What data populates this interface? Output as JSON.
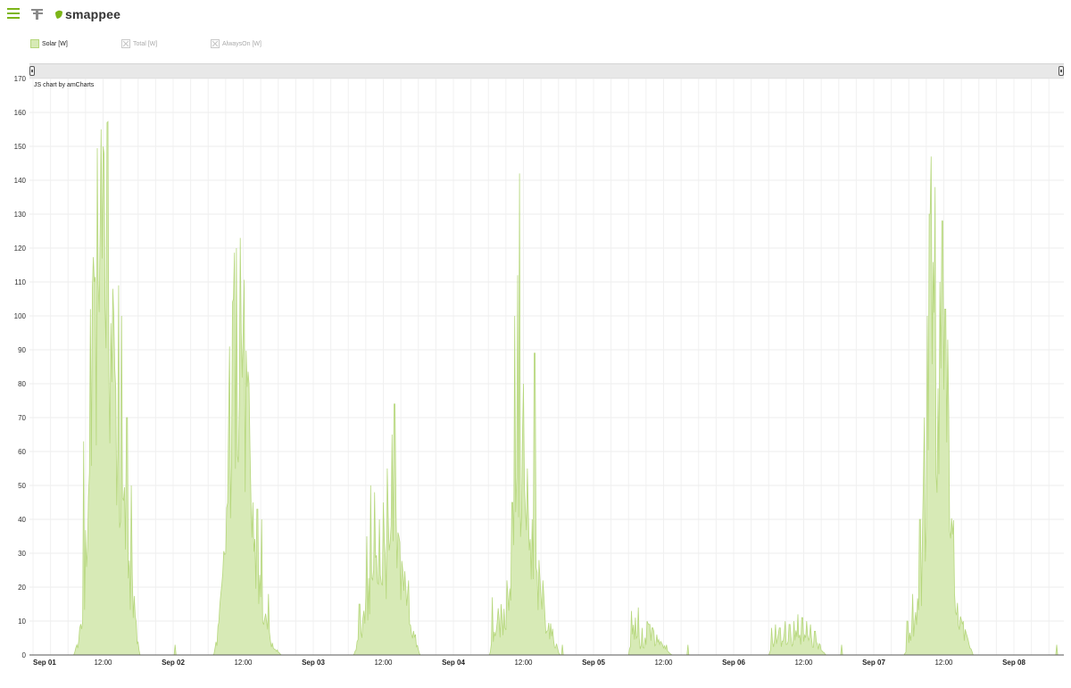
{
  "app": {
    "logo_text": "smappee"
  },
  "toolbar": {
    "menu_icon": "hamburger-icon",
    "filter_icon": "filter-icon"
  },
  "legend": [
    {
      "label": "Solar [W]",
      "active": true,
      "color": "#d7eab6"
    },
    {
      "label": "Total [W]",
      "active": false,
      "color": "#cccccc"
    },
    {
      "label": "AlwaysOn [W]",
      "active": false,
      "color": "#cccccc"
    }
  ],
  "credit": "JS chart by amCharts",
  "chart_data": {
    "type": "area",
    "series": [
      {
        "name": "Solar [W]",
        "color": "#d7eab6",
        "stroke": "#b6d77c"
      }
    ],
    "ylim": [
      0,
      170
    ],
    "yticks": [
      0,
      10,
      20,
      30,
      40,
      50,
      60,
      70,
      80,
      90,
      100,
      110,
      120,
      130,
      140,
      150,
      160,
      170
    ],
    "xlim_days": [
      0,
      8.2
    ],
    "xticks": [
      {
        "label": "Sep 01",
        "bold": true
      },
      {
        "label": "12:00",
        "bold": false
      },
      {
        "label": "Sep 02",
        "bold": true
      },
      {
        "label": "12:00",
        "bold": false
      },
      {
        "label": "Sep 03",
        "bold": true
      },
      {
        "label": "12:00",
        "bold": false
      },
      {
        "label": "Sep 04",
        "bold": true
      },
      {
        "label": "12:00",
        "bold": false
      },
      {
        "label": "Sep 05",
        "bold": true
      },
      {
        "label": "12:00",
        "bold": false
      },
      {
        "label": "Sep 06",
        "bold": true
      },
      {
        "label": "12:00",
        "bold": false
      },
      {
        "label": "Sep 07",
        "bold": true
      },
      {
        "label": "12:00",
        "bold": false
      },
      {
        "label": "Sep 08",
        "bold": true
      }
    ],
    "grid": true,
    "days": [
      {
        "start": 0.29,
        "end": 0.76,
        "anchors": [
          [
            0.29,
            0
          ],
          [
            0.32,
            4
          ],
          [
            0.35,
            10
          ],
          [
            0.37,
            28
          ],
          [
            0.4,
            55
          ],
          [
            0.42,
            90
          ],
          [
            0.45,
            120
          ],
          [
            0.48,
            140
          ],
          [
            0.5,
            150
          ],
          [
            0.52,
            145
          ],
          [
            0.55,
            120
          ],
          [
            0.58,
            95
          ],
          [
            0.61,
            70
          ],
          [
            0.64,
            50
          ],
          [
            0.67,
            40
          ],
          [
            0.7,
            25
          ],
          [
            0.73,
            12
          ],
          [
            0.76,
            0
          ]
        ],
        "spikes": [
          [
            0.36,
            63
          ],
          [
            0.41,
            102
          ],
          [
            0.44,
            110
          ],
          [
            0.46,
            135
          ],
          [
            0.485,
            155
          ],
          [
            0.5,
            150
          ],
          [
            0.53,
            157
          ],
          [
            0.57,
            108
          ],
          [
            0.61,
            109
          ],
          [
            0.63,
            100
          ],
          [
            0.67,
            70
          ],
          [
            0.7,
            50
          ]
        ]
      },
      {
        "start": 1.29,
        "end": 1.77,
        "anchors": [
          [
            1.29,
            0
          ],
          [
            1.31,
            5
          ],
          [
            1.34,
            15
          ],
          [
            1.37,
            35
          ],
          [
            1.4,
            65
          ],
          [
            1.43,
            100
          ],
          [
            1.46,
            118
          ],
          [
            1.49,
            110
          ],
          [
            1.52,
            85
          ],
          [
            1.55,
            55
          ],
          [
            1.58,
            35
          ],
          [
            1.61,
            25
          ],
          [
            1.64,
            15
          ],
          [
            1.67,
            8
          ],
          [
            1.7,
            4
          ],
          [
            1.74,
            2
          ],
          [
            1.77,
            0
          ]
        ],
        "spikes": [
          [
            1.34,
            18
          ],
          [
            1.4,
            91
          ],
          [
            1.43,
            105
          ],
          [
            1.45,
            120
          ],
          [
            1.48,
            123
          ],
          [
            1.5,
            96
          ],
          [
            1.54,
            80
          ],
          [
            1.57,
            45
          ],
          [
            1.6,
            43
          ],
          [
            1.63,
            40
          ],
          [
            1.68,
            18
          ]
        ]
      },
      {
        "start": 2.29,
        "end": 2.76,
        "anchors": [
          [
            2.29,
            0
          ],
          [
            2.32,
            5
          ],
          [
            2.36,
            12
          ],
          [
            2.4,
            20
          ],
          [
            2.44,
            28
          ],
          [
            2.48,
            30
          ],
          [
            2.52,
            34
          ],
          [
            2.55,
            35
          ],
          [
            2.58,
            37
          ],
          [
            2.61,
            35
          ],
          [
            2.64,
            28
          ],
          [
            2.67,
            18
          ],
          [
            2.7,
            10
          ],
          [
            2.73,
            5
          ],
          [
            2.76,
            0
          ]
        ],
        "spikes": [
          [
            2.33,
            15
          ],
          [
            2.38,
            35
          ],
          [
            2.41,
            50
          ],
          [
            2.44,
            48
          ],
          [
            2.47,
            40
          ],
          [
            2.5,
            45
          ],
          [
            2.53,
            55
          ],
          [
            2.56,
            65
          ],
          [
            2.58,
            74
          ],
          [
            2.61,
            35
          ],
          [
            2.64,
            25
          ],
          [
            2.68,
            22
          ]
        ]
      },
      {
        "start": 3.26,
        "end": 3.76,
        "anchors": [
          [
            3.26,
            0
          ],
          [
            3.29,
            8
          ],
          [
            3.32,
            12
          ],
          [
            3.35,
            10
          ],
          [
            3.38,
            15
          ],
          [
            3.41,
            25
          ],
          [
            3.44,
            50
          ],
          [
            3.47,
            60
          ],
          [
            3.5,
            55
          ],
          [
            3.53,
            40
          ],
          [
            3.56,
            30
          ],
          [
            3.59,
            25
          ],
          [
            3.62,
            20
          ],
          [
            3.65,
            15
          ],
          [
            3.68,
            10
          ],
          [
            3.72,
            5
          ],
          [
            3.76,
            0
          ]
        ],
        "spikes": [
          [
            3.28,
            17
          ],
          [
            3.34,
            15
          ],
          [
            3.38,
            22
          ],
          [
            3.42,
            45
          ],
          [
            3.44,
            100
          ],
          [
            3.46,
            112
          ],
          [
            3.47,
            142
          ],
          [
            3.5,
            80
          ],
          [
            3.53,
            55
          ],
          [
            3.56,
            40
          ],
          [
            3.58,
            89
          ],
          [
            3.61,
            28
          ],
          [
            3.64,
            22
          ]
        ]
      },
      {
        "start": 4.25,
        "end": 4.56,
        "anchors": [
          [
            4.25,
            0
          ],
          [
            4.27,
            6
          ],
          [
            4.29,
            9
          ],
          [
            4.31,
            7
          ],
          [
            4.33,
            4
          ],
          [
            4.35,
            2
          ],
          [
            4.37,
            5
          ],
          [
            4.39,
            8
          ],
          [
            4.41,
            7
          ],
          [
            4.43,
            6
          ],
          [
            4.45,
            5
          ],
          [
            4.47,
            4
          ],
          [
            4.5,
            3
          ],
          [
            4.53,
            1
          ],
          [
            4.56,
            0
          ]
        ],
        "spikes": [
          [
            4.27,
            13
          ],
          [
            4.3,
            11
          ],
          [
            4.32,
            14
          ],
          [
            4.35,
            8
          ],
          [
            4.38,
            10
          ],
          [
            4.4,
            9
          ],
          [
            4.42,
            8
          ],
          [
            4.45,
            6
          ],
          [
            4.48,
            4
          ],
          [
            4.52,
            3
          ]
        ]
      },
      {
        "start": 5.25,
        "end": 5.66,
        "anchors": [
          [
            5.25,
            0
          ],
          [
            5.28,
            4
          ],
          [
            5.31,
            6
          ],
          [
            5.34,
            5
          ],
          [
            5.37,
            7
          ],
          [
            5.4,
            5
          ],
          [
            5.43,
            6
          ],
          [
            5.46,
            8
          ],
          [
            5.49,
            6
          ],
          [
            5.52,
            5
          ],
          [
            5.55,
            6
          ],
          [
            5.58,
            4
          ],
          [
            5.61,
            3
          ],
          [
            5.64,
            1
          ],
          [
            5.66,
            0
          ]
        ],
        "spikes": [
          [
            5.27,
            8
          ],
          [
            5.3,
            9
          ],
          [
            5.33,
            8
          ],
          [
            5.37,
            10
          ],
          [
            5.4,
            9
          ],
          [
            5.43,
            10
          ],
          [
            5.46,
            12
          ],
          [
            5.49,
            11
          ],
          [
            5.52,
            10
          ],
          [
            5.55,
            9
          ],
          [
            5.58,
            7
          ],
          [
            5.62,
            3
          ]
        ]
      },
      {
        "start": 6.22,
        "end": 6.71,
        "anchors": [
          [
            6.22,
            0
          ],
          [
            6.25,
            5
          ],
          [
            6.28,
            10
          ],
          [
            6.31,
            18
          ],
          [
            6.34,
            30
          ],
          [
            6.37,
            60
          ],
          [
            6.4,
            90
          ],
          [
            6.43,
            120
          ],
          [
            6.46,
            95
          ],
          [
            6.49,
            110
          ],
          [
            6.52,
            80
          ],
          [
            6.55,
            50
          ],
          [
            6.58,
            25
          ],
          [
            6.61,
            12
          ],
          [
            6.64,
            8
          ],
          [
            6.67,
            5
          ],
          [
            6.71,
            0
          ]
        ],
        "spikes": [
          [
            6.24,
            10
          ],
          [
            6.28,
            18
          ],
          [
            6.33,
            40
          ],
          [
            6.36,
            70
          ],
          [
            6.38,
            100
          ],
          [
            6.4,
            130
          ],
          [
            6.41,
            147
          ],
          [
            6.44,
            138
          ],
          [
            6.47,
            110
          ],
          [
            6.49,
            128
          ],
          [
            6.51,
            102
          ],
          [
            6.53,
            93
          ],
          [
            6.56,
            30
          ],
          [
            6.6,
            15
          ],
          [
            6.64,
            10
          ]
        ]
      }
    ]
  }
}
